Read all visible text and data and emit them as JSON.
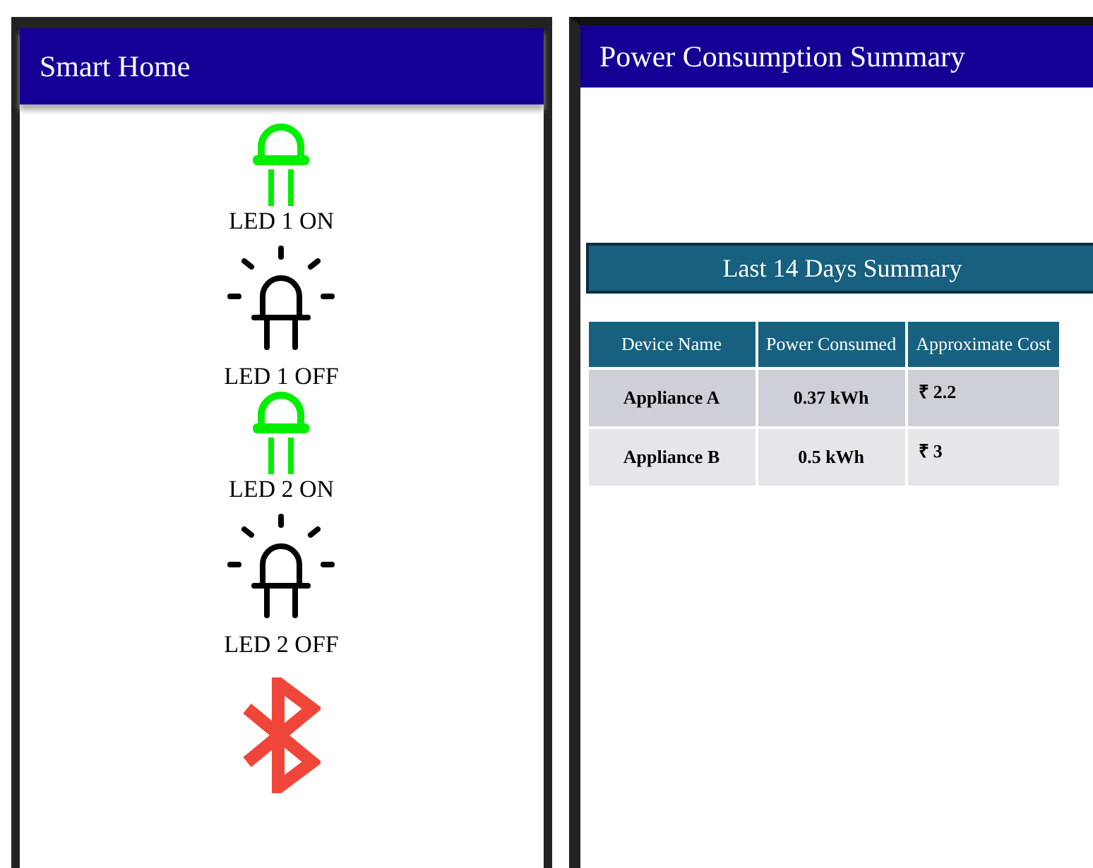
{
  "smart_home": {
    "title": "Smart Home",
    "items": [
      {
        "label": "LED 1 ON",
        "kind": "on"
      },
      {
        "label": "LED 1 OFF",
        "kind": "off"
      },
      {
        "label": "LED 2 ON",
        "kind": "on"
      },
      {
        "label": "LED 2 OFF",
        "kind": "off"
      }
    ]
  },
  "power": {
    "title": "Power Consumption Summary",
    "banner": "Last 14 Days Summary",
    "table": {
      "columns": [
        "Device Name",
        "Power Consumed",
        "Approximate Cost"
      ],
      "rows": [
        [
          "Appliance A",
          "0.37 kWh",
          "₹ 2.2"
        ],
        [
          "Appliance B",
          "0.5 kWh",
          "₹ 3"
        ]
      ]
    }
  }
}
